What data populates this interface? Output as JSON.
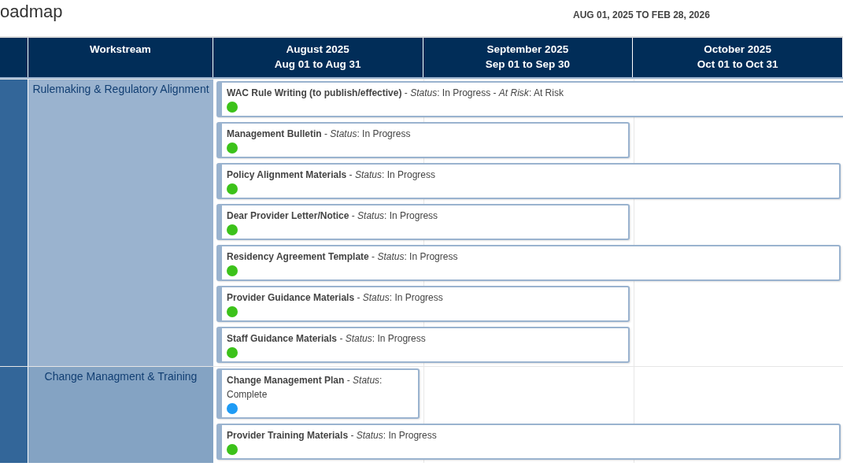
{
  "title": "oadmap",
  "date_range": "AUG 01, 2025 TO FEB 28, 2026",
  "columns": [
    {
      "title": "Workstream"
    },
    {
      "title": "August 2025",
      "range": "Aug 01 to Aug 31"
    },
    {
      "title": "September 2025",
      "range": "Sep 01 to Sep 30"
    },
    {
      "title": "October 2025",
      "range": "Oct 01 to Oct 31"
    }
  ],
  "workstreams": [
    {
      "name": "Rulemaking & Regulatory Alignment",
      "color": "#9ab3cf",
      "tasks": [
        {
          "label": "**WAC Rule Writing (to publish/effective)** - *Status*: In Progress - *At Risk*: At Risk",
          "kind": "beyond",
          "color": "#3cc21a"
        },
        {
          "label": "**Management Bulletin** - *Status*: In Progress",
          "kind": "sep",
          "color": "#3cc21a"
        },
        {
          "label": "**Policy Alignment Materials** - *Status*: In Progress",
          "kind": "oct",
          "color": "#3cc21a"
        },
        {
          "label": "**Dear Provider Letter/Notice** - *Status*: In Progress",
          "kind": "sep",
          "color": "#3cc21a"
        },
        {
          "label": "**Residency Agreement Template** - *Status*: In Progress",
          "kind": "oct",
          "color": "#3cc21a"
        },
        {
          "label": "**Provider Guidance Materials** - *Status*: In Progress",
          "kind": "sep",
          "color": "#3cc21a"
        },
        {
          "label": "**Staff Guidance Materials** - *Status*: In Progress",
          "kind": "sep",
          "color": "#3cc21a"
        }
      ]
    },
    {
      "name": "Change Managment & Training",
      "color": "#84a3c3",
      "tasks": [
        {
          "label": "**Change Management Plan** - *Status*: Complete",
          "kind": "aug",
          "color": "#1e9bf5"
        },
        {
          "label": "**Provider Training Materials** - *Status*: In Progress",
          "kind": "oct",
          "color": "#3cc21a"
        }
      ]
    }
  ]
}
